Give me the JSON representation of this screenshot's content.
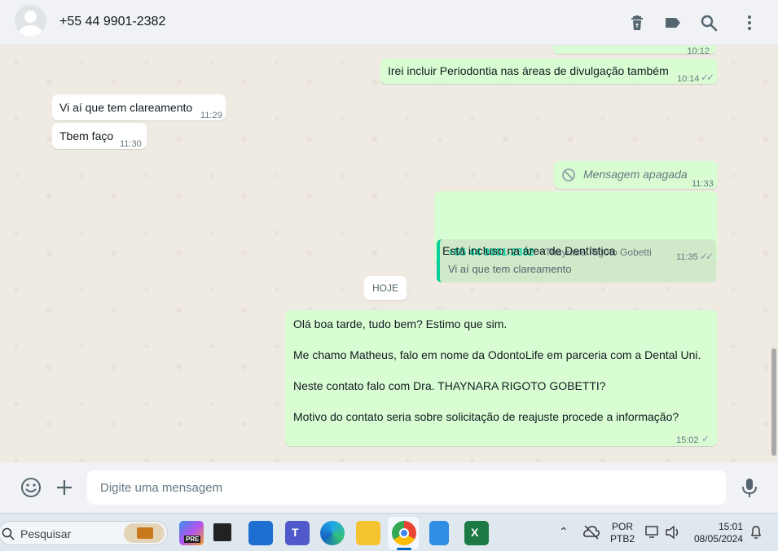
{
  "header": {
    "contact": "+55 44 9901-2382",
    "icons": [
      "delete-icon",
      "label-icon",
      "search-icon",
      "menu-icon"
    ]
  },
  "messages": {
    "m0": {
      "time": "10:12"
    },
    "m1": {
      "text": "Irei incluir Periodontia nas áreas de divulgação também",
      "time": "10:14",
      "status": "read"
    },
    "m2": {
      "text": "Vi aí que tem clareamento",
      "time": "11:29"
    },
    "m3": {
      "text": "Tbem faço",
      "time": "11:30"
    },
    "m4": {
      "text": "Mensagem apagada",
      "time": "11:33"
    },
    "m5": {
      "quote_author": "+55 44 9901-2382",
      "quote_name": "~Thaynara Rigoto Gobetti",
      "quote_text": "Vi aí que tem clareamento",
      "text": "Está incluso na área de Dentística",
      "time": "11:35",
      "status": "read"
    },
    "date_divider": "HOJE",
    "m6": {
      "line1": "Olá boa tarde, tudo bem? Estimo que sim.",
      "line2": "Me chamo Matheus, falo em nome da OdontoLife em parceria com a Dental Uni.",
      "line3": "Neste contato falo com Dra. THAYNARA RIGOTO GOBETTI?",
      "line4": "Motivo do contato seria sobre solicitação de reajuste procede a informação?",
      "time": "15:02",
      "status": "sent"
    }
  },
  "composer": {
    "placeholder": "Digite uma mensagem",
    "icons": [
      "emoji-icon",
      "plus-icon",
      "microphone-icon"
    ]
  },
  "taskbar": {
    "search_label": "Pesquisar",
    "copilot_badge": "PRE",
    "lang_top": "POR",
    "lang_bottom": "PTB2",
    "clock_time": "15:01",
    "clock_date": "08/05/2024"
  },
  "colors": {
    "outgoing_bubble": "#d9fdd3",
    "incoming_bubble": "#ffffff",
    "chat_background": "#efeae2",
    "accent": "#06cf9c",
    "read_ticks": "#53bdeb"
  }
}
